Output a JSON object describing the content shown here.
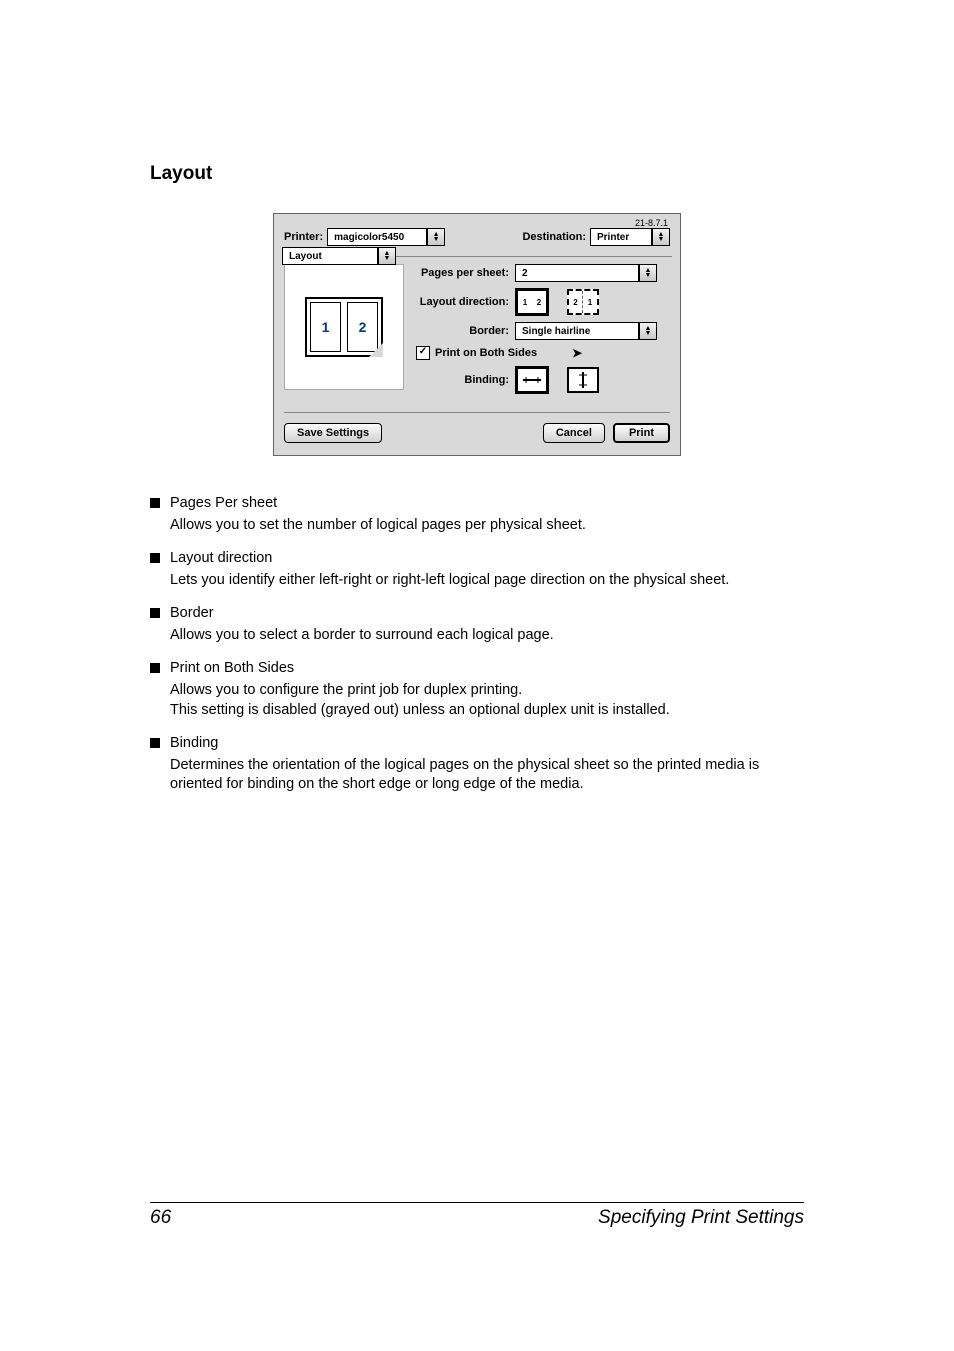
{
  "section_title": "Layout",
  "dialog": {
    "version": "21-8.7.1",
    "printer_label": "Printer:",
    "printer_value": "magicolor5450",
    "destination_label": "Destination:",
    "destination_value": "Printer",
    "tab_label": "Layout",
    "preview_pages": [
      "1",
      "2"
    ],
    "pages_per_sheet_label": "Pages per sheet:",
    "pages_per_sheet_value": "2",
    "layout_direction_label": "Layout direction:",
    "layout_direction_icon1": [
      "1",
      "2"
    ],
    "layout_direction_icon2": [
      "2",
      "1"
    ],
    "border_label": "Border:",
    "border_value": "Single hairline",
    "print_both_sides_label": "Print on Both Sides",
    "print_both_sides_checked": true,
    "binding_label": "Binding:",
    "save_settings": "Save Settings",
    "cancel": "Cancel",
    "print": "Print"
  },
  "items": [
    {
      "term": "Pages Per sheet",
      "desc": "Allows you to set the number of logical pages per physical sheet."
    },
    {
      "term": "Layout direction",
      "desc": "Lets you identify either left-right or right-left logical page direction on the physical sheet."
    },
    {
      "term": "Border",
      "desc": "Allows you to select a border to surround each logical page."
    },
    {
      "term": "Print on Both Sides",
      "desc": "Allows you to configure the print job for duplex printing.\nThis setting is disabled (grayed out) unless an optional duplex unit is installed."
    },
    {
      "term": "Binding",
      "desc": "Determines the orientation of the logical pages on the physical sheet so the printed media is oriented for binding on the short edge or long edge of the media."
    }
  ],
  "footer": {
    "page_number": "66",
    "title": "Specifying Print Settings"
  }
}
